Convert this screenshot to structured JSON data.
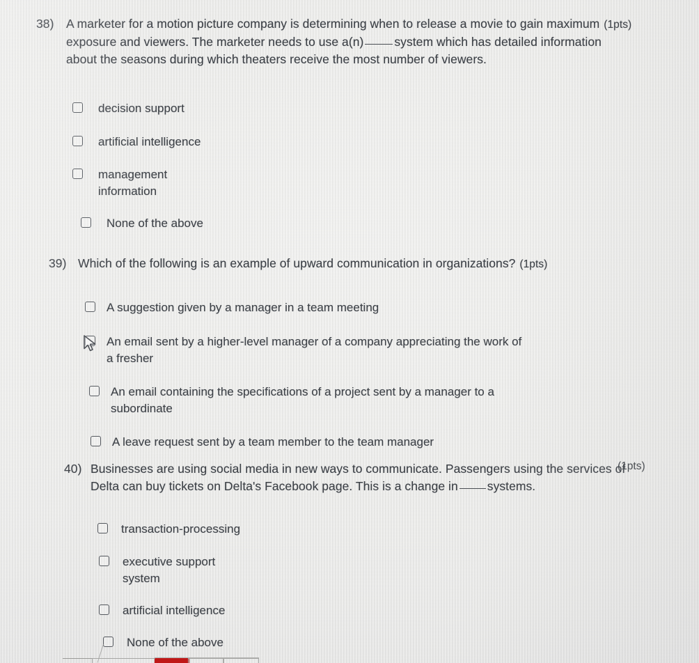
{
  "document": {
    "type": "multiple-choice-quiz-photo",
    "background_color": "#e9e9e7",
    "text_color": "#3c4046"
  },
  "questions": [
    {
      "number": "38)",
      "points": "(1pts)",
      "text_line1": "A marketer for a motion picture company is determining when to release a movie to gain maximum",
      "text_line2_before_blank": "exposure and viewers. The marketer needs to use a(n)",
      "text_line2_after_blank": "system which has detailed information",
      "text_line3": "about the seasons during which theaters receive the most number of viewers.",
      "options": [
        {
          "label": "decision support",
          "label_line2": "",
          "checked": false
        },
        {
          "label": "artificial intelligence",
          "label_line2": "",
          "checked": false
        },
        {
          "label": "management",
          "label_line2": "information",
          "checked": false
        },
        {
          "label": "None of the above",
          "label_line2": "",
          "checked": false
        }
      ]
    },
    {
      "number": "39)",
      "points": "(1pts)",
      "text_line1": "Which of the following is an example of upward communication in organizations?",
      "options": [
        {
          "label": "A suggestion given by a manager in a team meeting",
          "label_line2": "",
          "checked": false
        },
        {
          "label": "An email sent by a higher-level manager of a company appreciating the work of",
          "label_line2": "a fresher",
          "checked": false
        },
        {
          "label": "An email containing the specifications of a project sent by a manager to a",
          "label_line2": "subordinate",
          "checked": false
        },
        {
          "label": "A leave request sent by a team member to the team manager",
          "label_line2": "",
          "checked": false
        }
      ]
    },
    {
      "number": "40)",
      "points": "(1pts)",
      "text_line1": "Businesses are using social media in new ways to communicate. Passengers using the services of",
      "text_line2_before_blank": "Delta can buy tickets on Delta's Facebook page. This is a change in",
      "text_line2_after_blank": "systems.",
      "options": [
        {
          "label": "transaction-processing",
          "label_line2": "",
          "checked": false
        },
        {
          "label": "executive support",
          "label_line2": "system",
          "checked": false
        },
        {
          "label": "artificial intelligence",
          "label_line2": "",
          "checked": false
        },
        {
          "label": "None of the above",
          "label_line2": "",
          "checked": false
        }
      ]
    }
  ],
  "cursor": {
    "icon": "mouse-pointer-icon",
    "over_element": "question-39-option-2-checkbox"
  },
  "bottom_toolbar": {
    "visible_fragment": true,
    "highlight_color": "#c01818"
  }
}
